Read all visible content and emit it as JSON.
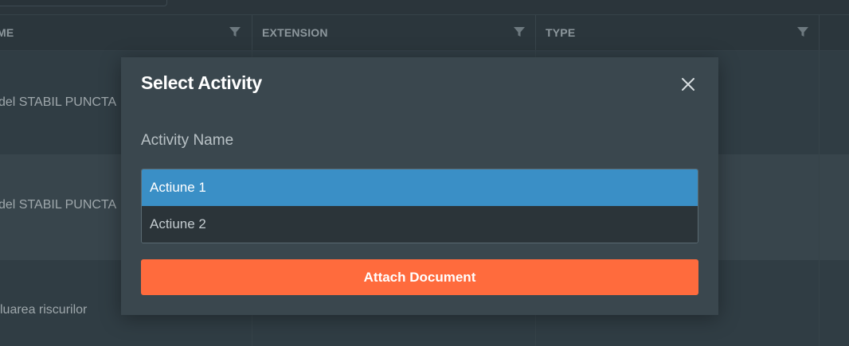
{
  "colors": {
    "background": "#333f46",
    "modal_background": "#3a474e",
    "accent_selected": "#3a8fc6",
    "primary_button": "#ff6b3d"
  },
  "grid": {
    "columns": [
      {
        "label": "ME",
        "icon": "filter-icon"
      },
      {
        "label": "EXTENSION",
        "icon": "filter-icon"
      },
      {
        "label": "TYPE",
        "icon": "filter-icon"
      }
    ],
    "rows": [
      {
        "name": "del STABIL PUNCTA"
      },
      {
        "name": "del STABIL PUNCTA"
      },
      {
        "name": "luarea riscurilor"
      }
    ]
  },
  "modal": {
    "title": "Select Activity",
    "close_icon": "close-icon",
    "field_label": "Activity Name",
    "options": [
      "Actiune 1",
      "Actiune 2"
    ],
    "selected": "Actiune 1",
    "button_label": "Attach Document"
  }
}
